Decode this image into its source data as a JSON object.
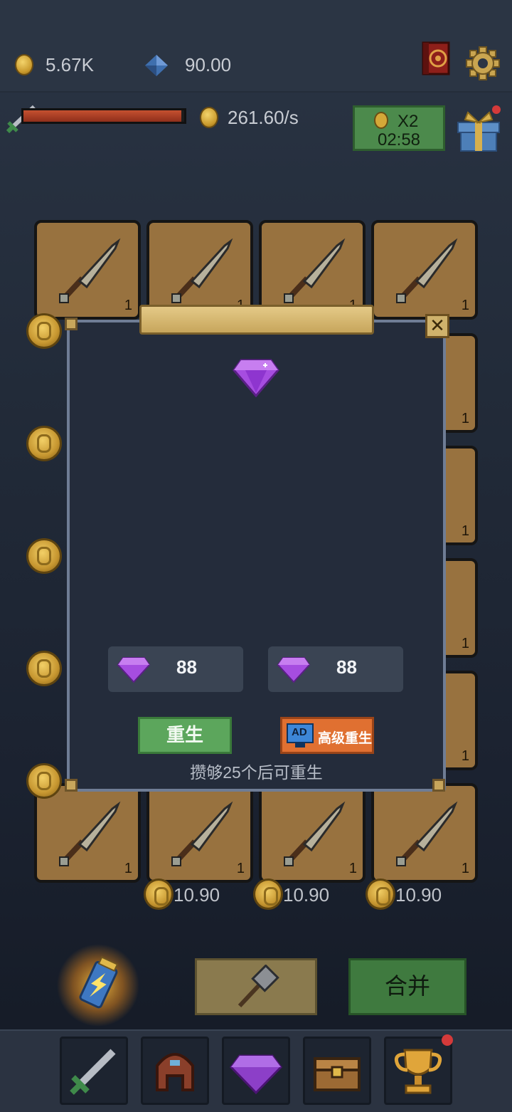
{
  "top_bar": {
    "coins": "5.67K",
    "gems": "90.00",
    "income_rate": "261.60/s",
    "boost": {
      "multiplier": "X2",
      "timer": "02:58"
    }
  },
  "grid": {
    "card_level": "1",
    "prices": [
      "10.90",
      "10.90",
      "10.90"
    ]
  },
  "modal": {
    "rebirth_reward": "88",
    "advanced_rebirth_reward": "88",
    "rebirth_label": "重生",
    "advanced_rebirth_label": "高级重生",
    "ad_badge": "AD",
    "hint": "攒够25个后可重生"
  },
  "actions": {
    "merge_label": "合并"
  },
  "bottom_nav": {
    "items": [
      "sword-icon",
      "helmet-icon",
      "gem-icon",
      "chest-icon",
      "trophy-icon"
    ]
  },
  "colors": {
    "accent_green": "#5ca65c",
    "accent_orange": "#e07031",
    "gem_purple": "#a64de0",
    "card_bg": "#98723f"
  }
}
